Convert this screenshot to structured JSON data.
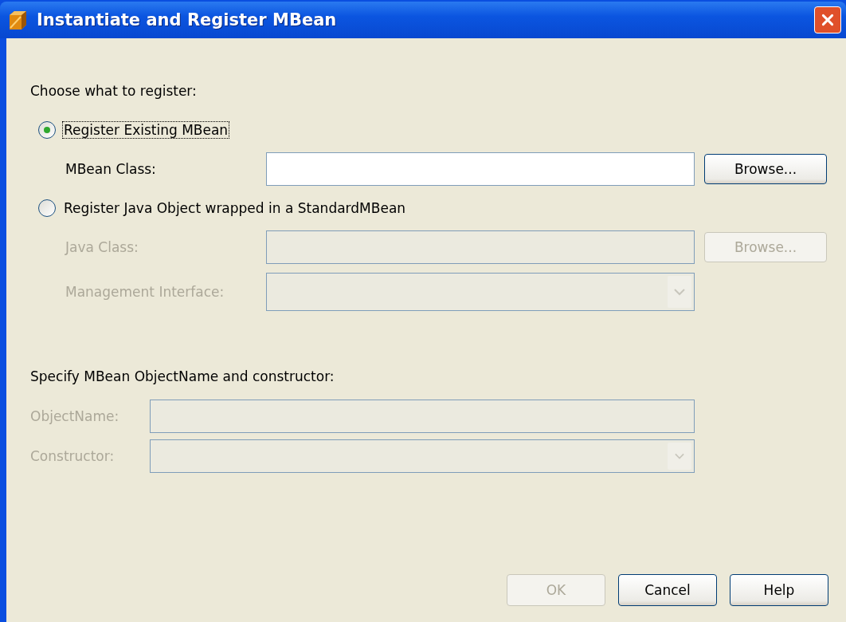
{
  "window": {
    "title": "Instantiate and Register MBean"
  },
  "choose_label": "Choose what to register:",
  "options": [
    {
      "label": "Register Existing MBean",
      "selected": true,
      "focused": true,
      "fields": [
        {
          "kind": "text",
          "label": "MBean Class:",
          "disabled": false,
          "button": "Browse..."
        }
      ]
    },
    {
      "label": "Register Java Object wrapped in a StandardMBean",
      "selected": false,
      "focused": false,
      "fields": [
        {
          "kind": "text",
          "label": "Java Class:",
          "disabled": true,
          "button": "Browse..."
        },
        {
          "kind": "combo",
          "label": "Management Interface:",
          "disabled": true
        }
      ]
    }
  ],
  "specify_label": "Specify MBean ObjectName and constructor:",
  "name_fields": [
    {
      "kind": "text",
      "label": "ObjectName:",
      "disabled": true
    },
    {
      "kind": "combo",
      "label": "Constructor:",
      "disabled": true
    }
  ],
  "buttons": [
    {
      "label": "OK",
      "disabled": true
    },
    {
      "label": "Cancel",
      "disabled": false
    },
    {
      "label": "Help",
      "disabled": false
    }
  ]
}
